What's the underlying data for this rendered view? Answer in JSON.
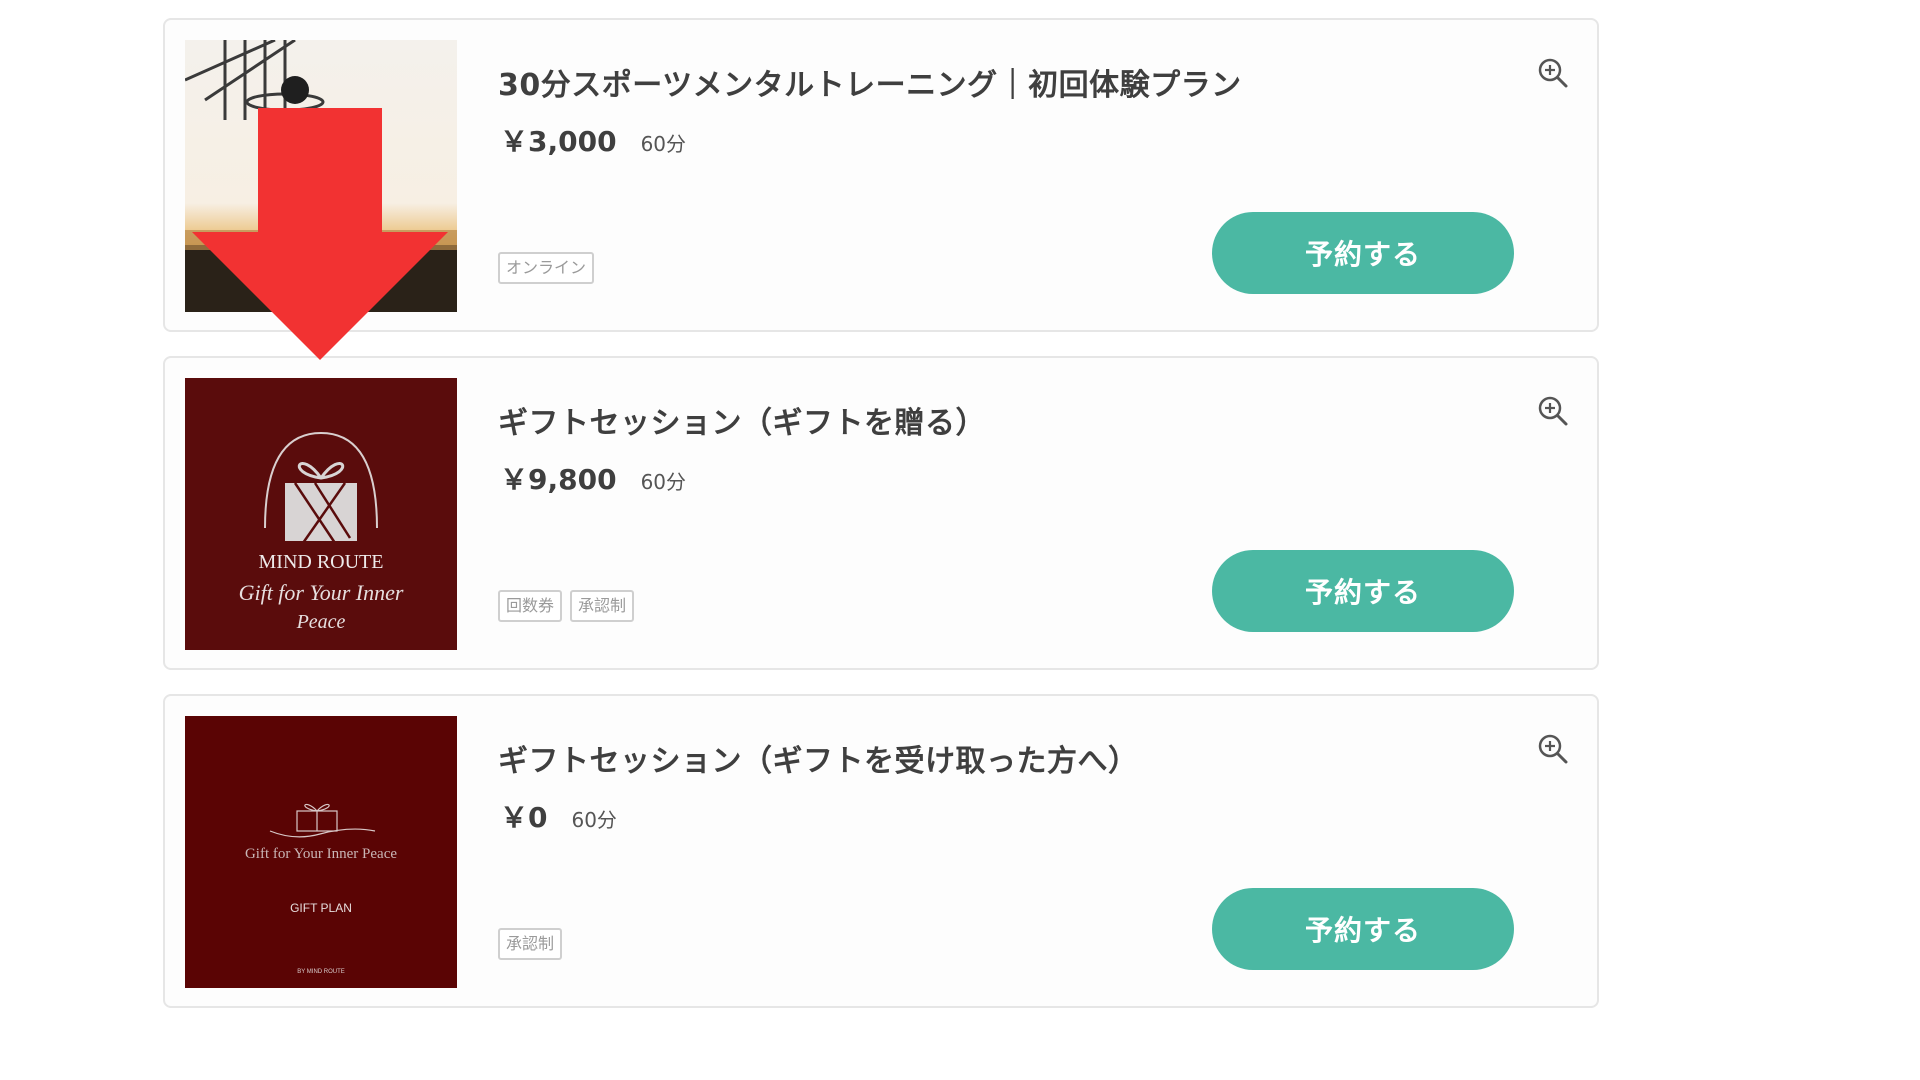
{
  "plans": [
    {
      "title": "30分スポーツメンタルトレーニング｜初回体験プラン",
      "price": "￥3,000",
      "duration": "60分",
      "tags": [
        "オンライン"
      ],
      "button_label": "予約する",
      "image": "basketball-hoop-photo"
    },
    {
      "title": "ギフトセッション（ギフトを贈る）",
      "price": "￥9,800",
      "duration": "60分",
      "tags": [
        "回数券",
        "承認制"
      ],
      "button_label": "予約する",
      "image": "mind-route-gift-logo",
      "image_text": {
        "brand": "MIND ROUTE",
        "script_line1": "Gift for Your Inner",
        "script_line2": "Peace"
      }
    },
    {
      "title": "ギフトセッション（ギフトを受け取った方へ）",
      "price": "￥0",
      "duration": "60分",
      "tags": [
        "承認制"
      ],
      "button_label": "予約する",
      "image": "gift-plan-logo",
      "image_text": {
        "tagline": "Gift for Your Inner Peace",
        "label": "GIFT PLAN",
        "footer": "BY MIND ROUTE"
      }
    }
  ],
  "colors": {
    "button": "#4bb8a3",
    "thumbnail_maroon": "#5a0c0c",
    "arrow": "#f23232",
    "card_border": "#e6e6e6",
    "tag_text": "#9a9a9a"
  },
  "icons": {
    "zoom": "zoom-in-icon",
    "annotation": "red-down-arrow"
  }
}
